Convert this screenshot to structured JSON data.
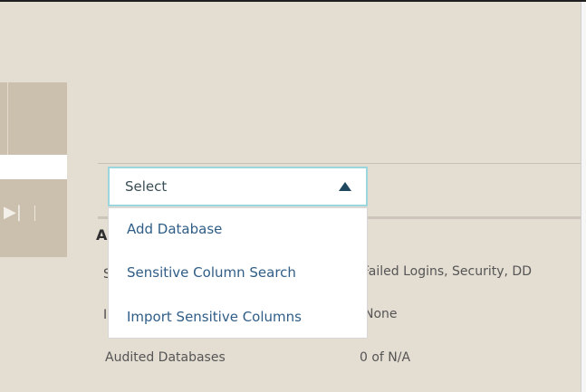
{
  "dropdown": {
    "value": "Select",
    "options": [
      "Add Database",
      "Sensitive Column Search",
      "Import Sensitive Columns"
    ]
  },
  "details": {
    "section_initial": "A",
    "row1_initial": "S",
    "row1_value": "Failed Logins, Security, DD",
    "row2_initial": "I",
    "row2_value": "None",
    "audited_label": "Audited Databases",
    "audited_value": "0 of N/A"
  },
  "icons": {
    "player_end": "▶|"
  },
  "colors": {
    "page_bg": "#e4ddd2",
    "toolbar_bg": "#cbbfae",
    "link": "#2f5d86",
    "select_border": "#9bd6de"
  }
}
